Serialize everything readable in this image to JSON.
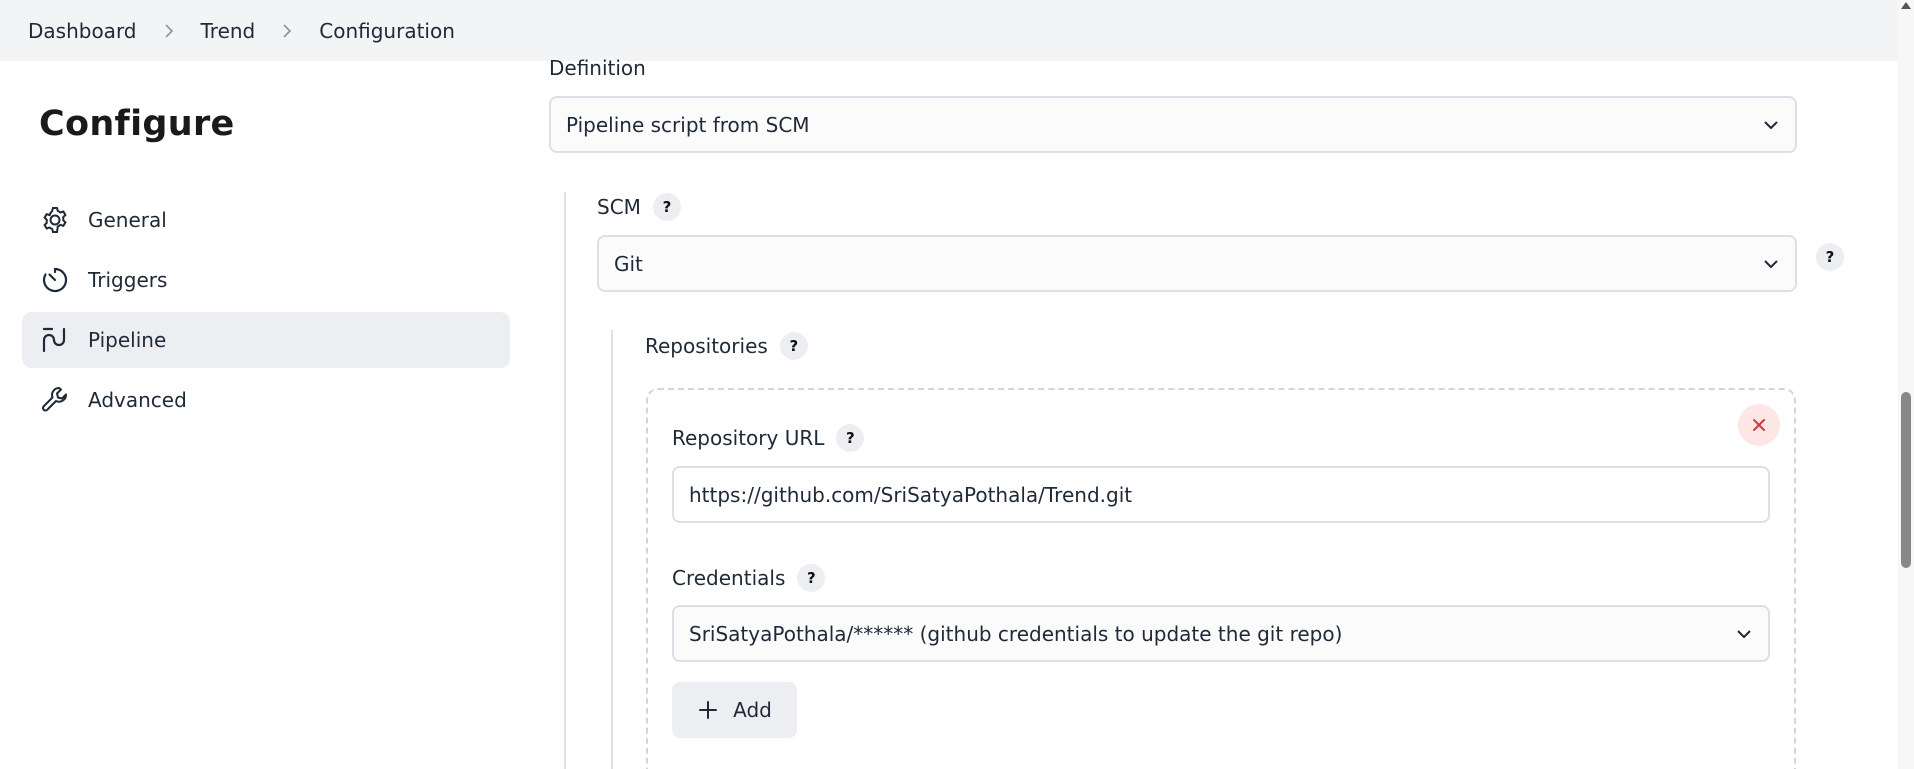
{
  "breadcrumb": {
    "items": [
      "Dashboard",
      "Trend",
      "Configuration"
    ]
  },
  "page_title": "Configure",
  "sidebar": {
    "items": [
      {
        "label": "General",
        "icon": "gear-icon",
        "active": false
      },
      {
        "label": "Triggers",
        "icon": "timer-icon",
        "active": false
      },
      {
        "label": "Pipeline",
        "icon": "pipeline-icon",
        "active": true
      },
      {
        "label": "Advanced",
        "icon": "wrench-icon",
        "active": false
      }
    ]
  },
  "form": {
    "definition_label": "Definition",
    "definition_value": "Pipeline script from SCM",
    "scm_label": "SCM",
    "scm_value": "Git",
    "repositories_label": "Repositories",
    "repo_url_label": "Repository URL",
    "repo_url_value": "https://github.com/SriSatyaPothala/Trend.git",
    "credentials_label": "Credentials",
    "credentials_value": "SriSatyaPothala/****** (github credentials to update the git repo)",
    "add_label": "Add",
    "help_glyph": "?"
  },
  "colors": {
    "topbar_bg": "#f3f4f6",
    "active_nav_bg": "#eceef2",
    "field_border": "#dcdfe6",
    "delete_bg": "#fde6e6",
    "delete_icon": "#d33b3b"
  }
}
